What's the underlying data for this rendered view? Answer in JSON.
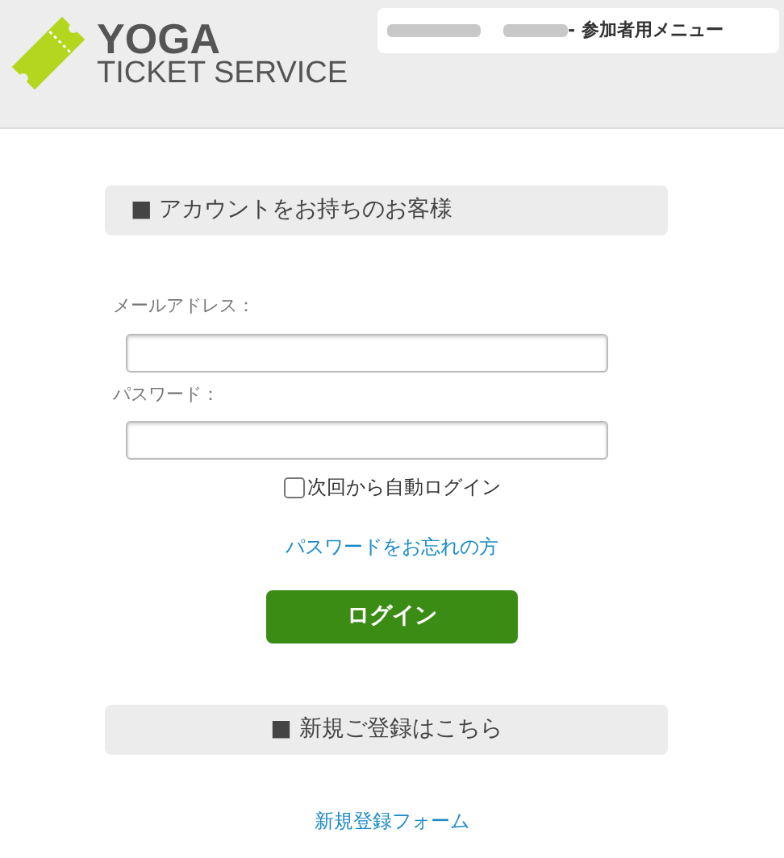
{
  "header": {
    "logo_title": "YOGA",
    "logo_subtitle": "TICKET SERVICE",
    "menu_title": "- 参加者用メニュー"
  },
  "login": {
    "heading": "■ アカウントをお持ちのお客様",
    "fields": [
      {
        "label": "メールアドレス："
      },
      {
        "label": "パスワード："
      }
    ],
    "remember": {
      "label": "次回から自動ログイン",
      "checked": false
    },
    "forgot_link": "パスワードをお忘れの方",
    "login_button": "ログイン"
  },
  "register": {
    "heading": "■ 新規ご登録はこちら",
    "link": "新規登録フォーム"
  }
}
